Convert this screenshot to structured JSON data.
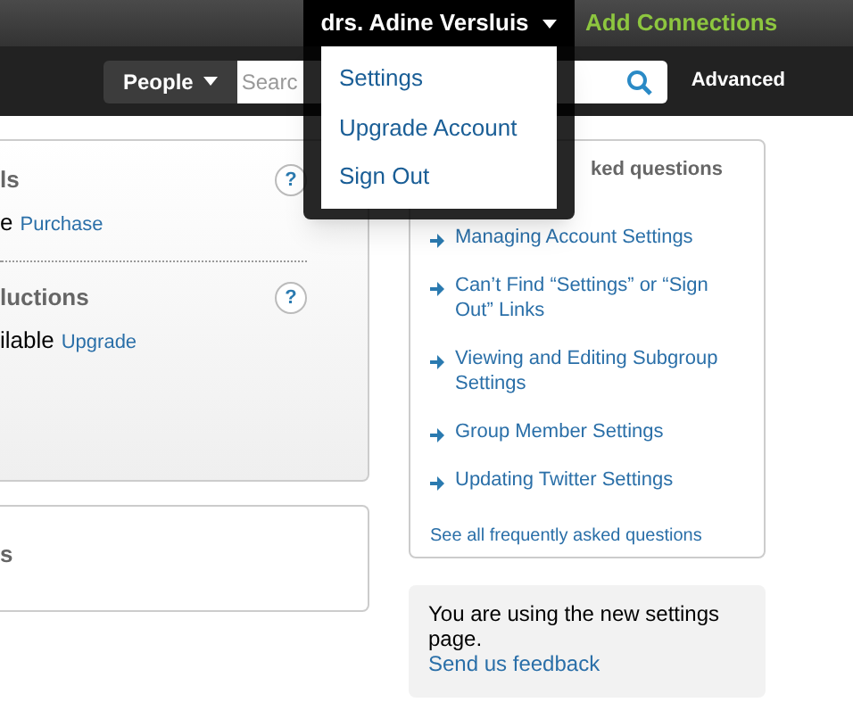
{
  "topbar": {
    "user_menu": {
      "label": "drs. Adine Versluis",
      "expanded": true,
      "items": [
        "Settings",
        "Upgrade Account",
        "Sign Out"
      ]
    },
    "add_connections": "Add Connections"
  },
  "search": {
    "scope": "People",
    "placeholder": "Searc",
    "advanced": "Advanced"
  },
  "left_panel": {
    "sections": [
      {
        "heading": "ls",
        "help": "?",
        "text": "e",
        "link": "Purchase"
      },
      {
        "heading": "luctions",
        "help": "?",
        "text": "ilable",
        "link": "Upgrade"
      }
    ]
  },
  "left_panel_2": {
    "heading": "s"
  },
  "faq": {
    "heading": "ked questions",
    "links": [
      "Managing Account Settings",
      "Can’t Find “Settings” or “Sign Out” Links",
      "Viewing and Editing Subgroup Settings",
      "Group Member Settings",
      "Updating Twitter Settings"
    ],
    "see_all": "See all frequently asked questions"
  },
  "feedback": {
    "text": "You are using the new settings page.",
    "link": "Send us feedback"
  }
}
